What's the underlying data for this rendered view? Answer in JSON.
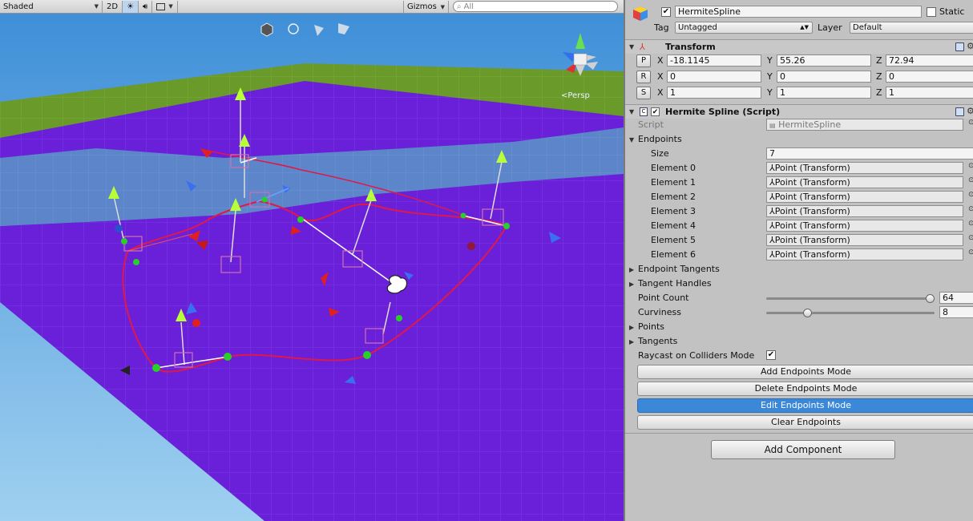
{
  "scene": {
    "toolbar": {
      "shading_mode": "Shaded",
      "mode_2d": "2D",
      "gizmos_label": "Gizmos",
      "search_placeholder": "All"
    },
    "projection_label": "<Persp"
  },
  "inspector": {
    "object_name": "HermiteSpline",
    "active": true,
    "static_label": "Static",
    "static_checked": false,
    "tag_label": "Tag",
    "tag_value": "Untagged",
    "layer_label": "Layer",
    "layer_value": "Default",
    "transform": {
      "title": "Transform",
      "position": {
        "label": "P",
        "x": "-18.1145",
        "y": "55.26",
        "z": "72.94"
      },
      "rotation": {
        "label": "R",
        "x": "0",
        "y": "0",
        "z": "0"
      },
      "scale": {
        "label": "S",
        "x": "1",
        "y": "1",
        "z": "1"
      },
      "axis_x": "X",
      "axis_y": "Y",
      "axis_z": "Z"
    },
    "spline": {
      "title": "Hermite Spline (Script)",
      "script_label": "Script",
      "script_value": "HermiteSpline",
      "endpoints_label": "Endpoints",
      "size_label": "Size",
      "size_value": "7",
      "elements": [
        {
          "label": "Element 0",
          "value": "Point (Transform)"
        },
        {
          "label": "Element 1",
          "value": "Point (Transform)"
        },
        {
          "label": "Element 2",
          "value": "Point (Transform)"
        },
        {
          "label": "Element 3",
          "value": "Point (Transform)"
        },
        {
          "label": "Element 4",
          "value": "Point (Transform)"
        },
        {
          "label": "Element 5",
          "value": "Point (Transform)"
        },
        {
          "label": "Element 6",
          "value": "Point (Transform)"
        }
      ],
      "endpoint_tangents_label": "Endpoint Tangents",
      "tangent_handles_label": "Tangent Handles",
      "point_count_label": "Point Count",
      "point_count_value": "64",
      "point_count_fraction": 1.0,
      "curviness_label": "Curviness",
      "curviness_value": "8",
      "curviness_fraction": 0.23,
      "points_label": "Points",
      "tangents_label": "Tangents",
      "raycast_label": "Raycast on Colliders Mode",
      "raycast_checked": true,
      "buttons": {
        "add": "Add Endpoints Mode",
        "delete": "Delete Endpoints Mode",
        "edit": "Edit Endpoints Mode",
        "clear": "Clear Endpoints"
      }
    },
    "add_component": "Add Component"
  },
  "colors": {
    "ground_purple": "#6a20d8",
    "grass_green": "#6a9a2a",
    "water_blue": "#5a90c8",
    "spline_red": "#e0184a",
    "active_button": "#3b87d8"
  }
}
